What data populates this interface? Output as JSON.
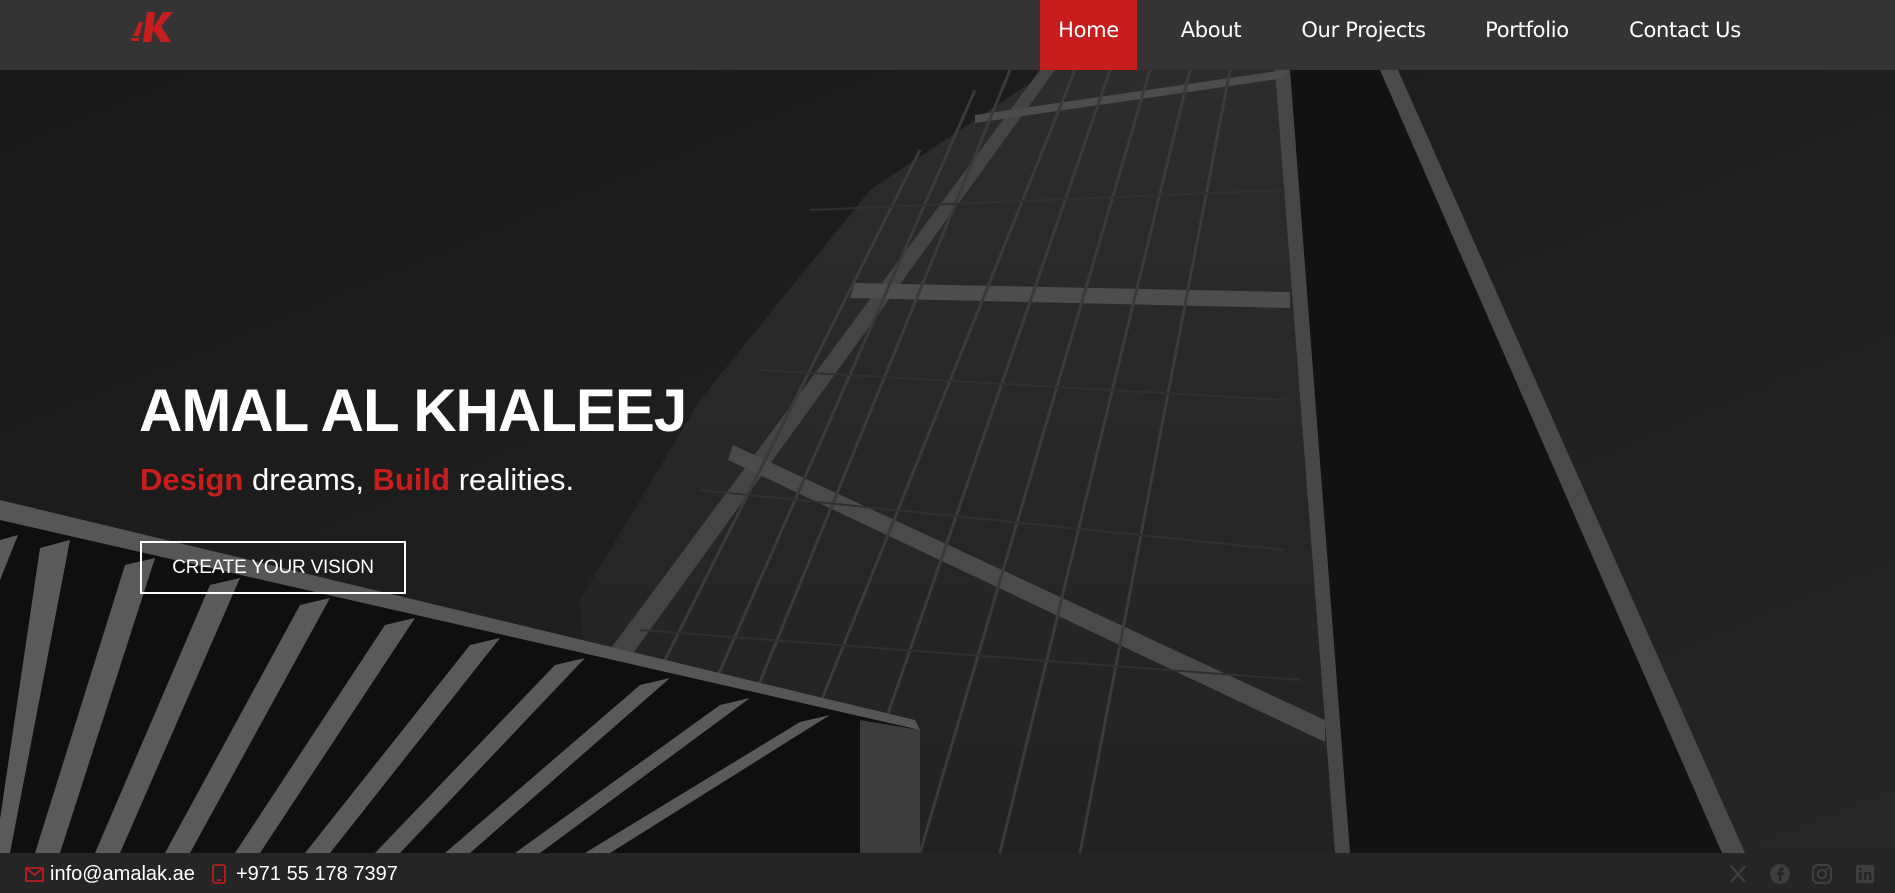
{
  "brand": {
    "logo_text": "AK",
    "accent_color": "#c81d1d"
  },
  "nav": {
    "items": [
      {
        "label": "Home",
        "active": true
      },
      {
        "label": "About",
        "active": false
      },
      {
        "label": "Our Projects",
        "active": false
      },
      {
        "label": "Portfolio",
        "active": false
      },
      {
        "label": "Contact Us",
        "active": false
      }
    ]
  },
  "hero": {
    "title": "AMAL AL KHALEEJ",
    "tagline": {
      "word1": "Design",
      "text1": " dreams, ",
      "word2": "Build",
      "text2": " realities."
    },
    "cta_label": "CREATE YOUR VISION"
  },
  "footer": {
    "email": "info@amalak.ae",
    "phone": "+971 55 178 7397",
    "social_icons": [
      "x-icon",
      "facebook-icon",
      "instagram-icon",
      "linkedin-icon"
    ]
  }
}
